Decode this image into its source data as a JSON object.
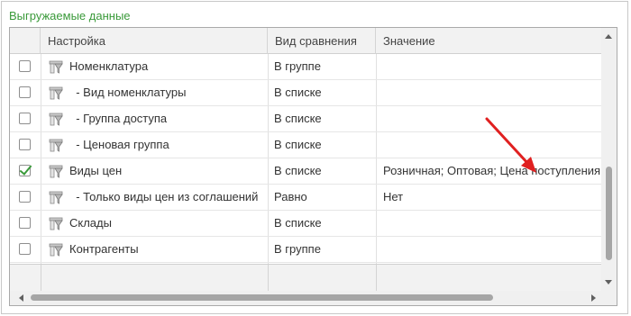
{
  "group": {
    "title": "Выгружаемые данные"
  },
  "columns": [
    "Настройка",
    "Вид сравнения",
    "Значение"
  ],
  "rows": [
    {
      "checked": false,
      "name": "Номенклатура",
      "comparison": "В группе",
      "value": ""
    },
    {
      "checked": false,
      "name": "  - Вид номенклатуры",
      "comparison": "В списке",
      "value": ""
    },
    {
      "checked": false,
      "name": "  - Группа доступа",
      "comparison": "В списке",
      "value": ""
    },
    {
      "checked": false,
      "name": "  - Ценовая группа",
      "comparison": "В списке",
      "value": ""
    },
    {
      "checked": true,
      "name": "Виды цен",
      "comparison": "В списке",
      "value": "Розничная; Оптовая; Цена поступления"
    },
    {
      "checked": false,
      "name": "  - Только виды цен из соглашений",
      "comparison": "Равно",
      "value": "Нет"
    },
    {
      "checked": false,
      "name": "Склады",
      "comparison": "В списке",
      "value": ""
    },
    {
      "checked": false,
      "name": "Контрагенты",
      "comparison": "В группе",
      "value": ""
    }
  ],
  "icons": {
    "row": "filter-field-icon",
    "check": "checkmark-icon"
  },
  "colors": {
    "accent": "#3a9a3a",
    "annotation_arrow": "#e02020"
  }
}
